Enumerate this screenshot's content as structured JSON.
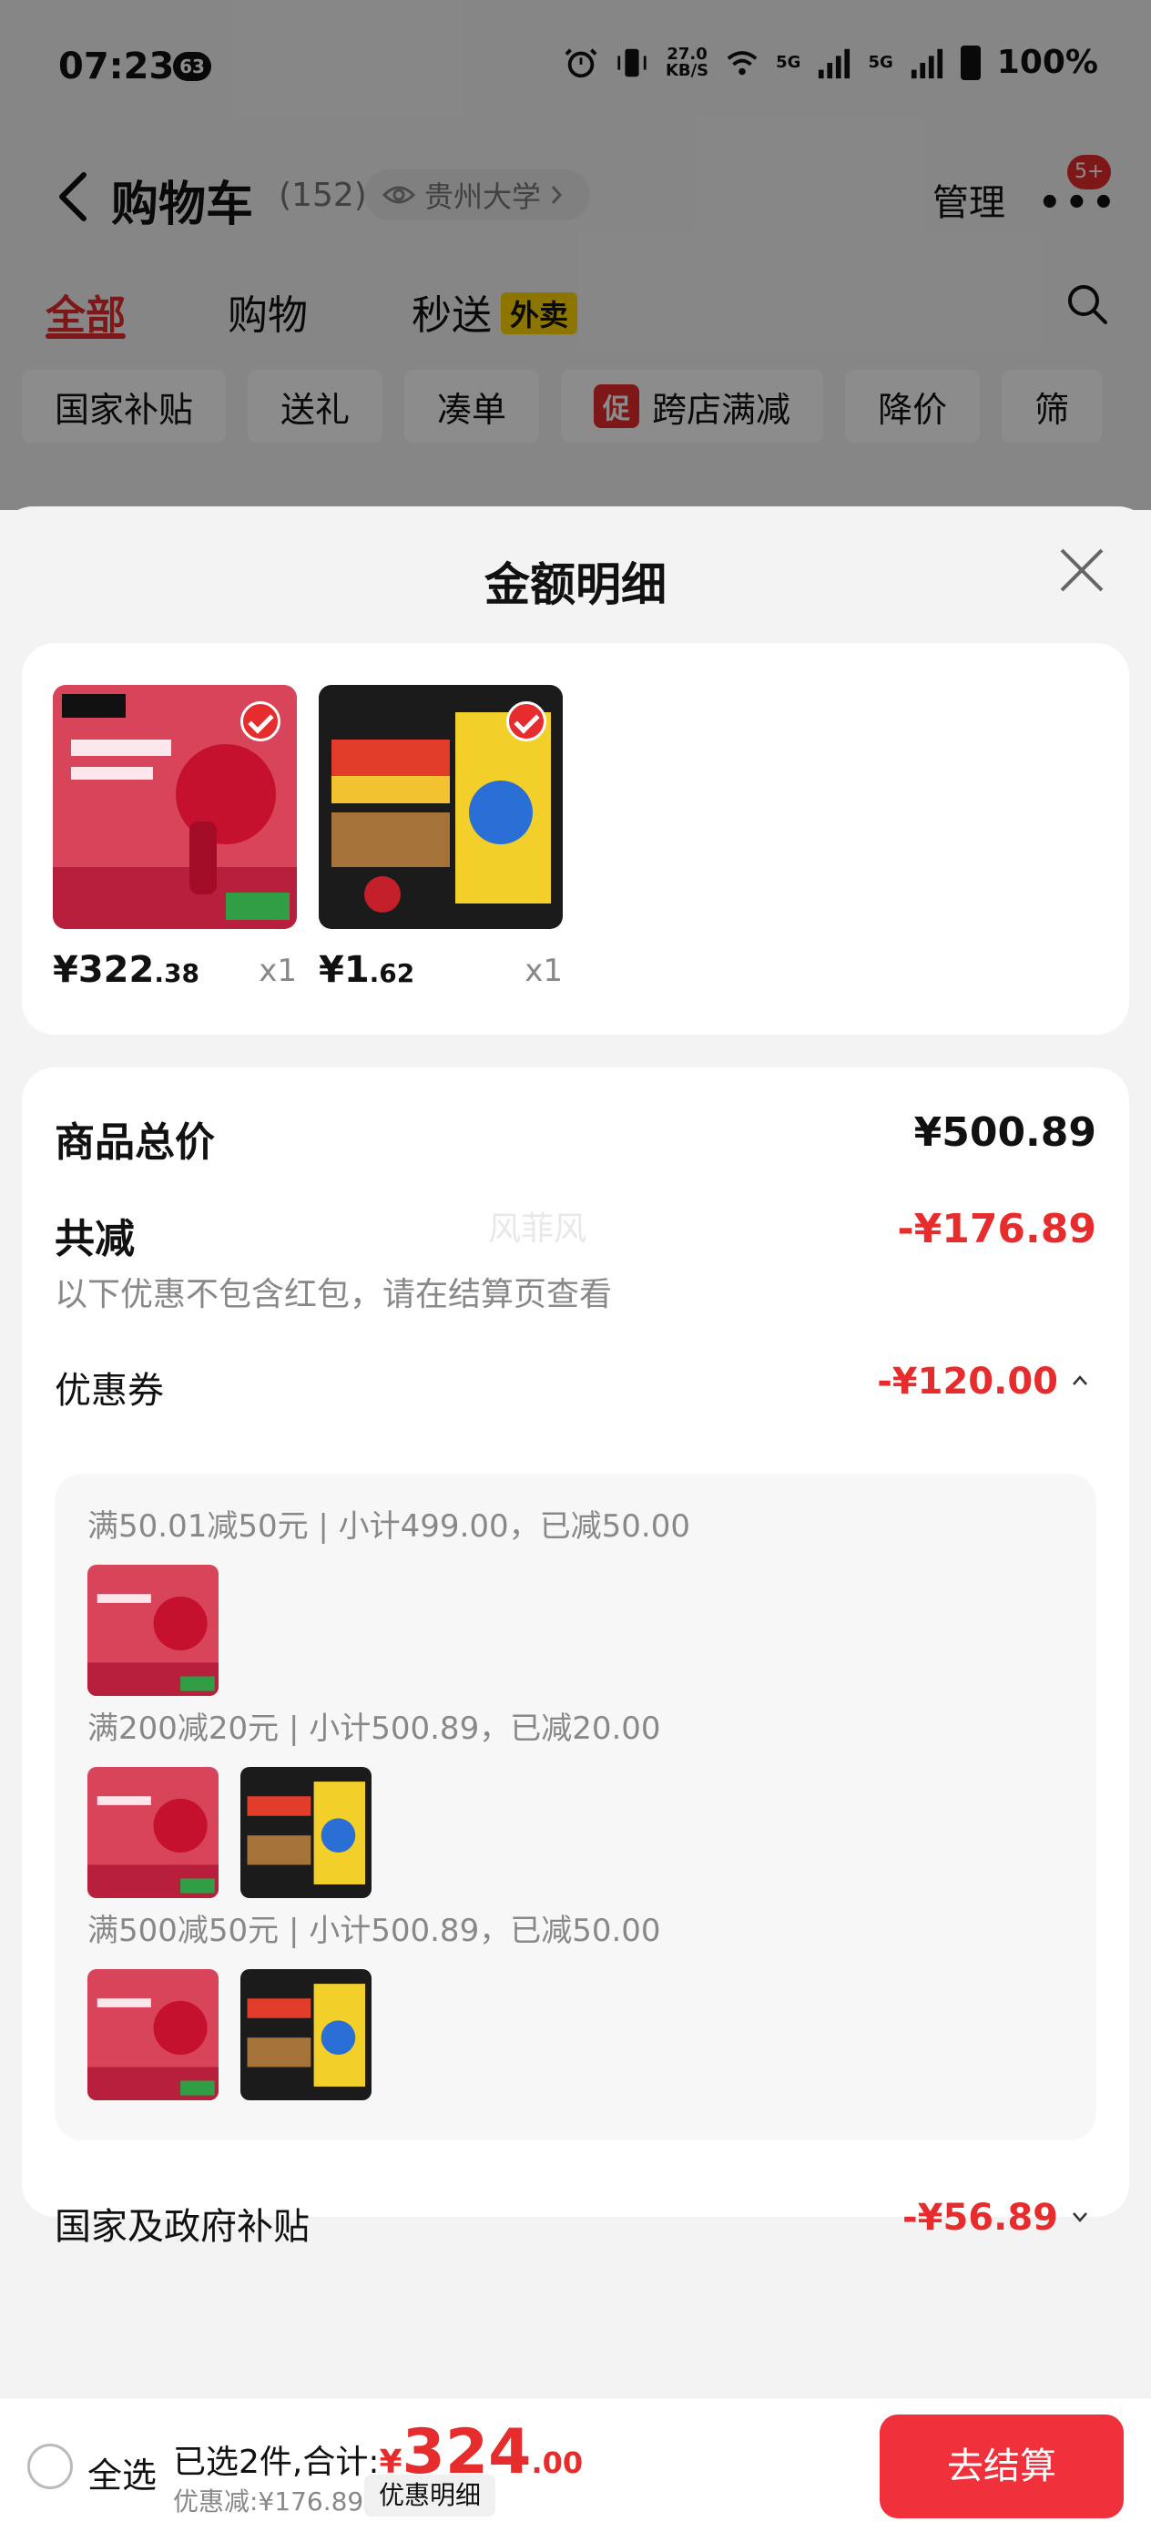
{
  "status_bar": {
    "time": "07:23",
    "badge": "63",
    "net_speed": "27.0",
    "net_unit": "KB/S",
    "sig1": "5G",
    "sig2": "5G",
    "battery": "100%"
  },
  "nav": {
    "title": "购物车",
    "count": "(152)",
    "location": "贵州大学",
    "manage": "管理",
    "more_badge": "5+"
  },
  "tabs": [
    {
      "label": "全部",
      "active": true
    },
    {
      "label": "购物",
      "active": false
    },
    {
      "label": "秒送",
      "active": false,
      "tag": "外卖"
    }
  ],
  "chips": [
    "国家补贴",
    "送礼",
    "凑单",
    "跨店满减",
    "降价",
    "筛"
  ],
  "chip_promo_mark": "促",
  "sheet": {
    "title": "金额明细",
    "goods": [
      {
        "price_int": "¥322",
        "price_dec": ".38",
        "qty": "x1",
        "thumb": "hair-dryer"
      },
      {
        "price_int": "¥1",
        "price_dec": ".62",
        "qty": "x1",
        "thumb": "fish-food"
      }
    ],
    "total_label": "商品总价",
    "total_value": "¥500.89",
    "reduce_label": "共减",
    "reduce_value": "-¥176.89",
    "reduce_note": "以下优惠不包含红包，请在结算页查看",
    "watermark": "风菲风",
    "coupon_label": "优惠券",
    "coupon_value": "-¥120.00",
    "coupons": [
      {
        "desc": "满50.01减50元 | 小计499.00，已减50.00",
        "thumbs": [
          "hair-dryer"
        ]
      },
      {
        "desc": "满200减20元 | 小计500.89，已减20.00",
        "thumbs": [
          "hair-dryer",
          "fish-food"
        ]
      },
      {
        "desc": "满500减50元 | 小计500.89，已减50.00",
        "thumbs": [
          "hair-dryer",
          "fish-food"
        ]
      }
    ],
    "subsidy_label": "国家及政府补贴",
    "subsidy_value": "-¥56.89"
  },
  "bottom": {
    "select_all": "全选",
    "selected_prefix": "已选2件,合计:",
    "currency": "¥",
    "total_int": "324",
    "total_dec": ".00",
    "discount": "优惠减:¥176.89",
    "detail_tag": "优惠明细",
    "checkout": "去结算"
  },
  "colors": {
    "accent": "#e62c2c",
    "checkout": "#f0313b"
  }
}
